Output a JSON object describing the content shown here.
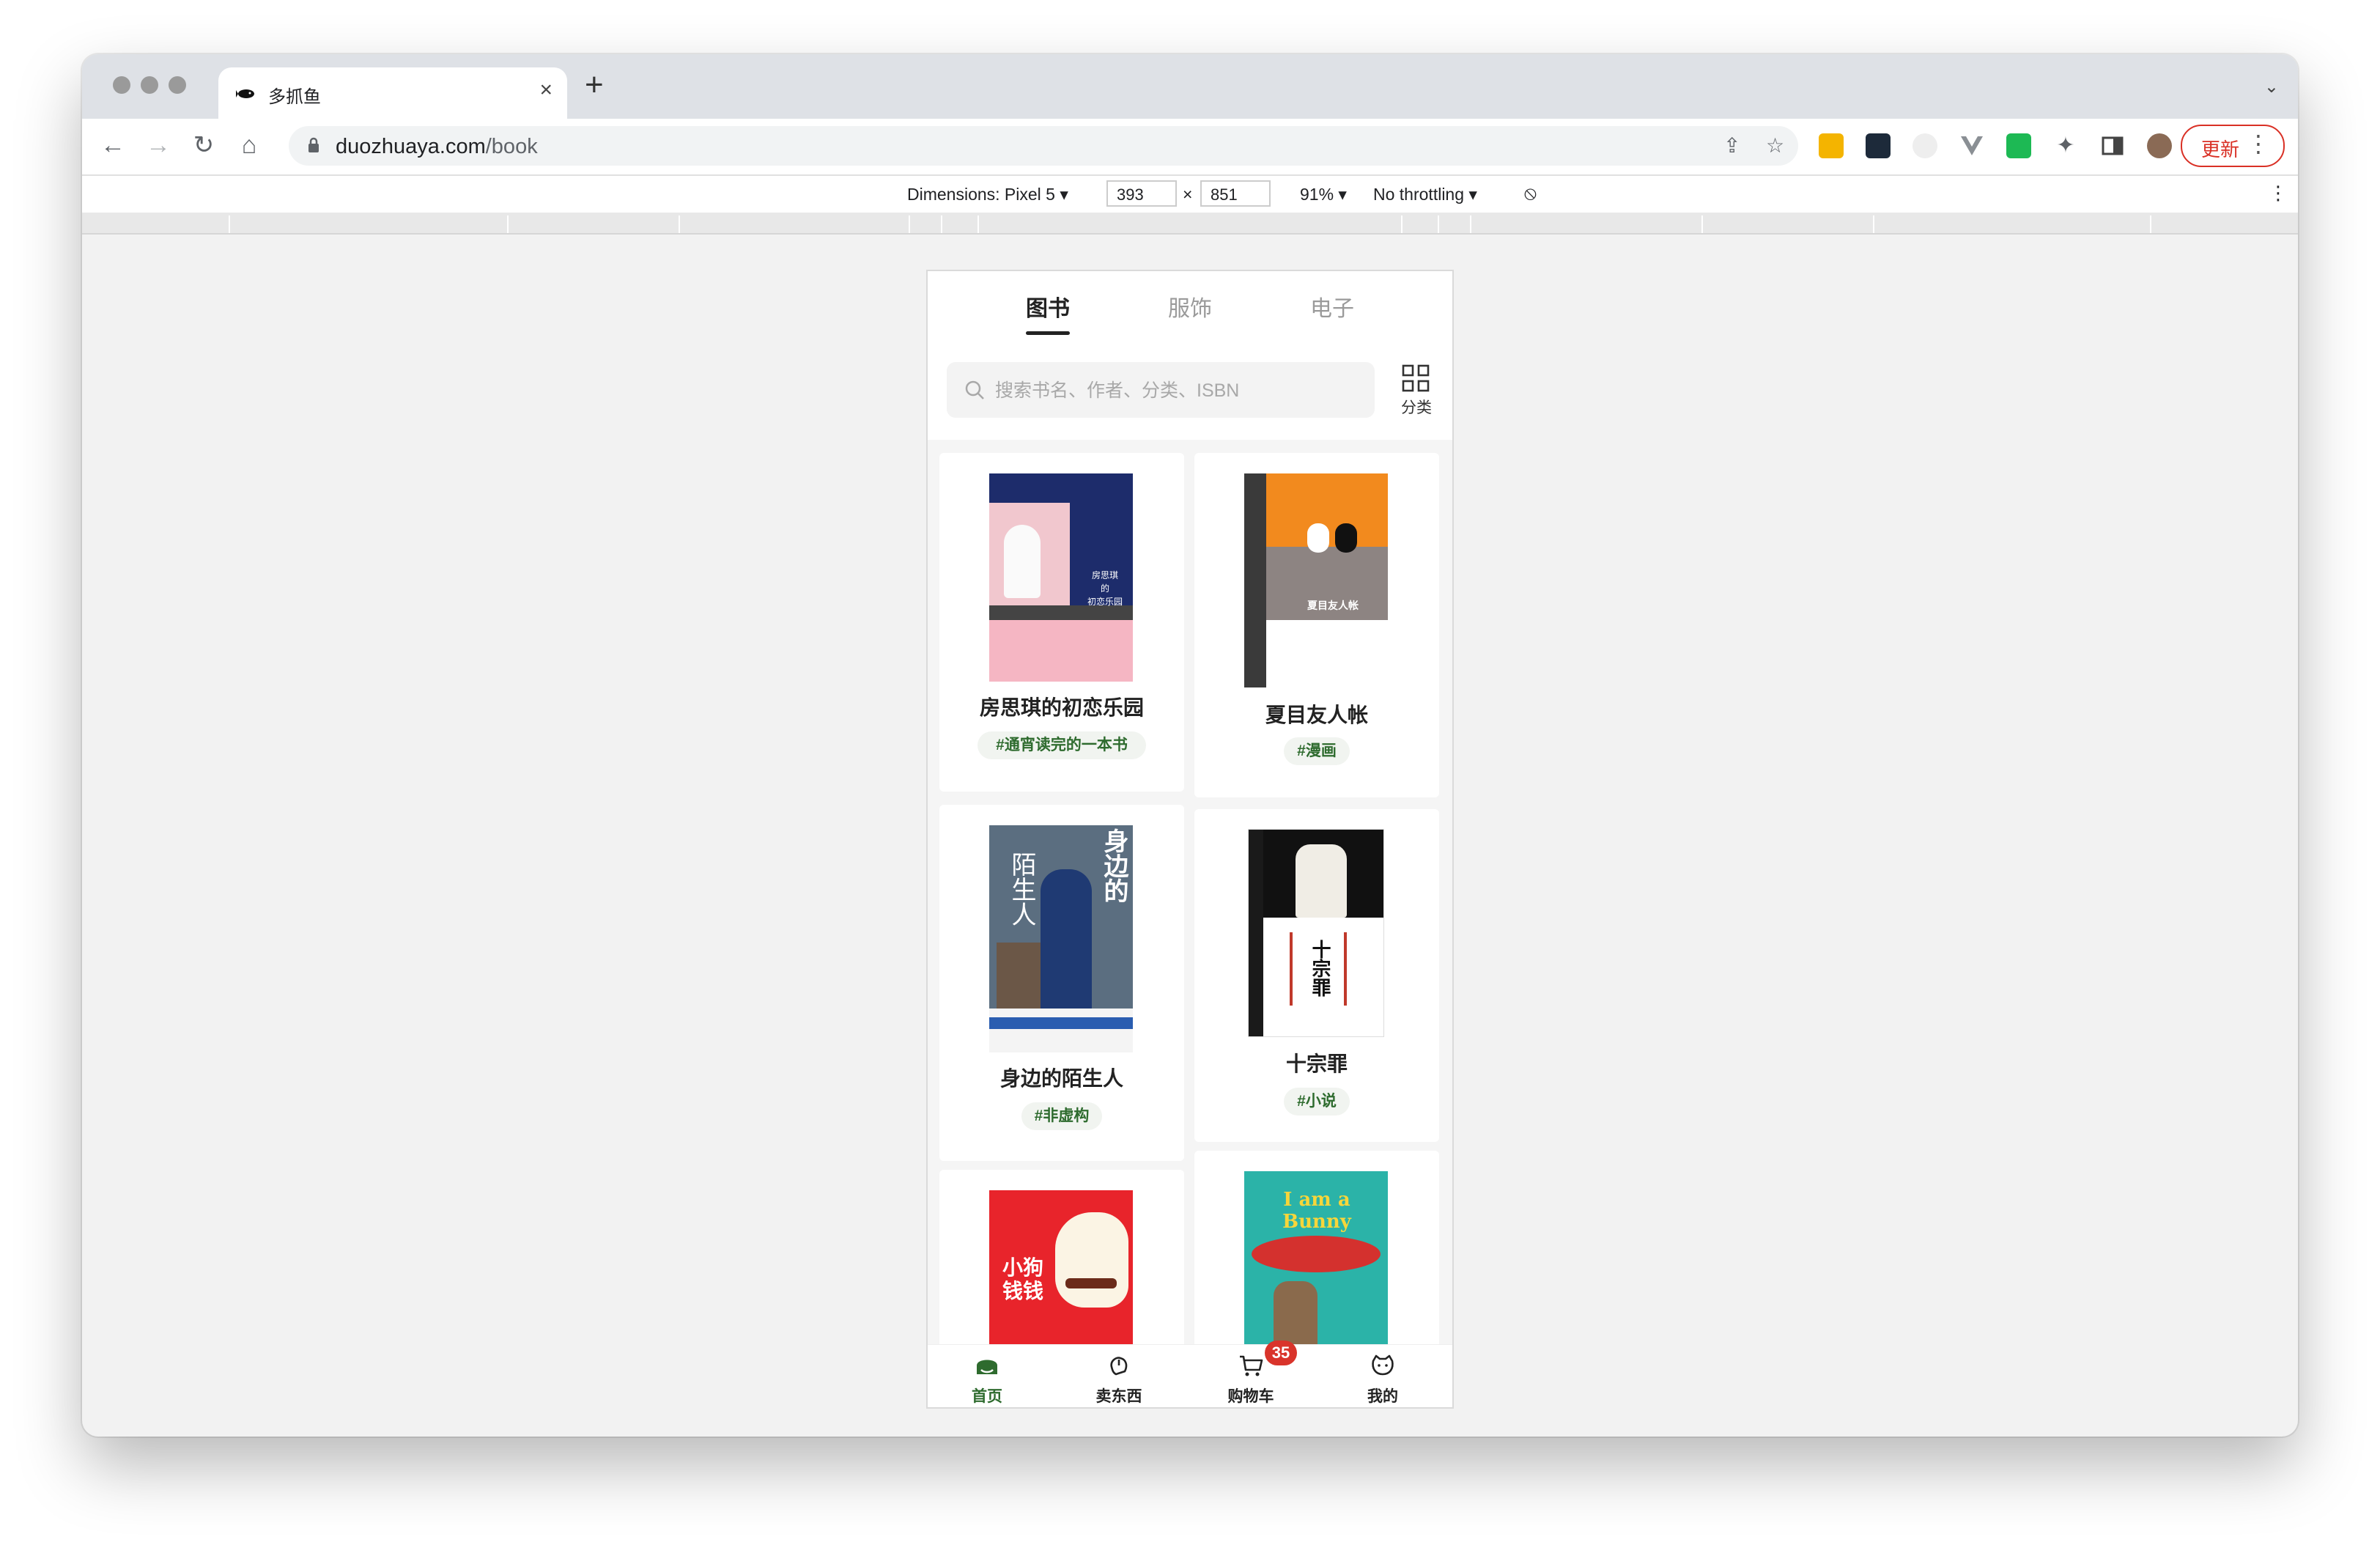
{
  "browser": {
    "tab_title": "多抓鱼",
    "url_domain": "duozhuaya.com",
    "url_path": "/book",
    "update_label": "更新",
    "new_tab_symbol": "+",
    "close_symbol": "×"
  },
  "devtools": {
    "dimensions_label": "Dimensions: Pixel 5 ▾",
    "width": "393",
    "times": "×",
    "height": "851",
    "zoom": "91% ▾",
    "throttling": "No throttling ▾"
  },
  "app": {
    "categories": [
      {
        "label": "图书",
        "active": true
      },
      {
        "label": "服饰",
        "active": false
      },
      {
        "label": "电子",
        "active": false
      }
    ],
    "search": {
      "placeholder": "搜索书名、作者、分类、ISBN",
      "value": ""
    },
    "category_button": "分类",
    "books": [
      {
        "title": "房思琪的初恋乐园",
        "tag": "#通宵读完的一本书"
      },
      {
        "title": "夏目友人帐",
        "tag": "#漫画"
      },
      {
        "title": "身边的陌生人",
        "tag": "#非虚构"
      },
      {
        "title": "十宗罪",
        "tag": "#小说"
      },
      {
        "title": "小狗钱钱",
        "tag": ""
      },
      {
        "title": "I am a Bunny",
        "tag": ""
      }
    ],
    "cover_texts": {
      "book1_line1": "房思琪",
      "book1_line2": "的",
      "book1_line3": "初恋乐园",
      "book2_cover": "夏目友人帐",
      "book3_cover_a": "身边的",
      "book3_cover_b": "陌生人",
      "book4_cover": "十宗罪",
      "book5_cover_a": "小狗",
      "book5_cover_b": "钱钱",
      "book6_cover": "I am a Bunny"
    },
    "tabbar": [
      {
        "label": "首页",
        "icon": "home-icon",
        "active": true
      },
      {
        "label": "卖东西",
        "icon": "hand-icon",
        "active": false
      },
      {
        "label": "购物车",
        "icon": "cart-icon",
        "active": false,
        "badge": "35"
      },
      {
        "label": "我的",
        "icon": "face-icon",
        "active": false
      }
    ]
  },
  "colors": {
    "accent_green": "#2e6b2e",
    "badge_red": "#d9342b",
    "update_red": "#d93025"
  }
}
